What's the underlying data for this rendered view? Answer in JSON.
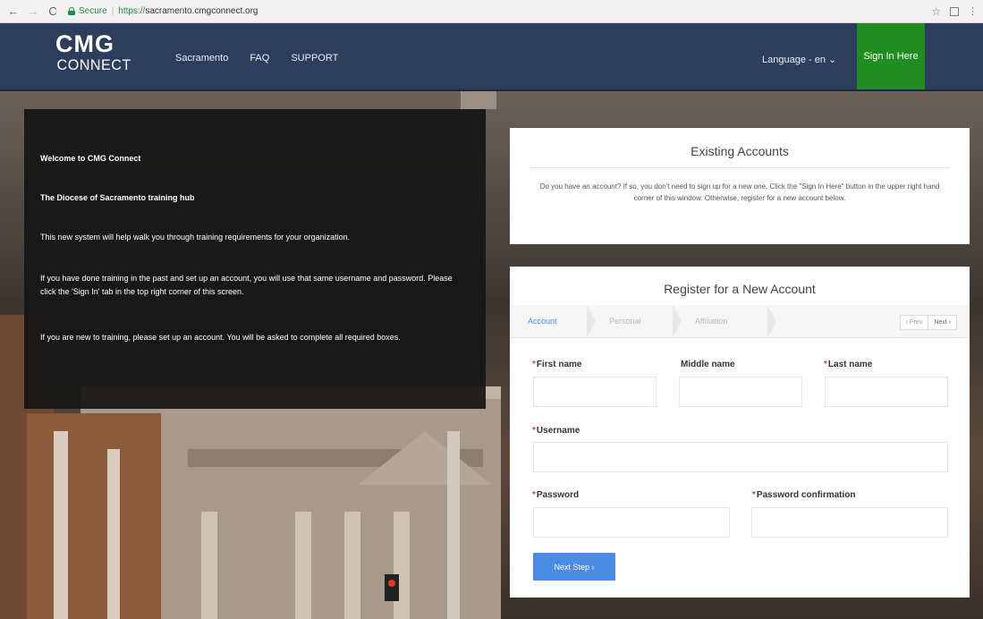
{
  "browser": {
    "secure_label": "Secure",
    "url_scheme": "https://",
    "url_host": "sacramento.cmgconnect.org",
    "star_icon": "☆"
  },
  "navbar": {
    "logo_top": "CMG",
    "logo_bottom": "CONNECT",
    "links": [
      "Sacramento",
      "FAQ",
      "SUPPORT"
    ],
    "language": "Language - en ⌄",
    "sign_in": "Sign In Here"
  },
  "welcome": {
    "title": "Welcome to CMG Connect",
    "subtitle": "The Diocese of Sacramento training hub",
    "para1": "This new system will help walk you through training requirements for your organization.",
    "para2": "If you have done training in the past and set up an account, you will use that same username and password.  Please click the 'Sign In' tab in the top right corner of this screen.",
    "para3": "If you are new to training, please set up an account.  You will be asked to complete all required boxes."
  },
  "existing": {
    "title": "Existing Accounts",
    "text": "Do you have an account? If so, you don't need to sign up for a new one. Click the \"Sign In Here\" button in the upper right hand corner of this window. Otherwise, register for a new account below."
  },
  "register": {
    "title": "Register for a New Account",
    "steps": [
      "Account",
      "Personal",
      "Affiliation"
    ],
    "pager_prev": "‹ Prev",
    "pager_next": "Next ›",
    "fields": {
      "first_name": "First name",
      "middle_name": "Middle name",
      "last_name": "Last name",
      "username": "Username",
      "password": "Password",
      "password_confirmation": "Password confirmation"
    },
    "required_mark": "*",
    "next_button": "Next Step ›"
  },
  "colors": {
    "navbar": "#2d3e5c",
    "sign_in": "#1f8d1f",
    "accent": "#4a8be6"
  }
}
